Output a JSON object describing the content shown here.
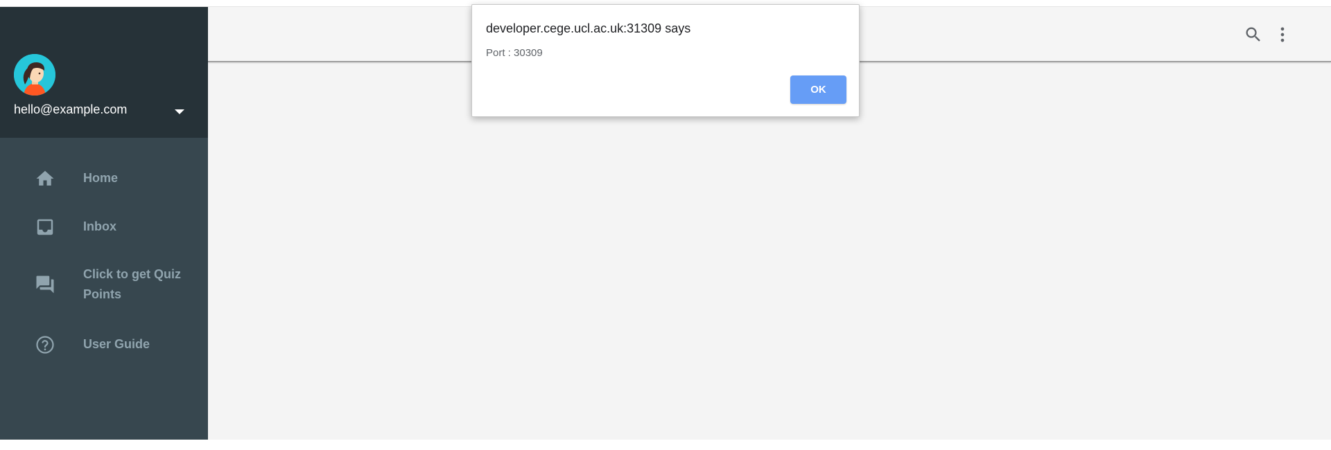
{
  "account": {
    "email": "hello@example.com"
  },
  "sidebar": {
    "items": [
      {
        "label": "Home",
        "icon": "home-icon"
      },
      {
        "label": "Inbox",
        "icon": "inbox-icon"
      },
      {
        "label": "Click to get Quiz Points",
        "icon": "forum-icon"
      },
      {
        "label": "User Guide",
        "icon": "help-icon"
      }
    ]
  },
  "toolbar": {
    "icons": [
      "search-icon",
      "more-vert-icon"
    ]
  },
  "dialog": {
    "title": "developer.cege.ucl.ac.uk:31309 says",
    "message": "Port : 30309",
    "ok_label": "OK"
  },
  "colors": {
    "sidebar_header": "#263238",
    "sidebar": "#37474f",
    "nav_text": "#90a4ae",
    "main_bg": "#f4f4f4",
    "ok_button": "#669df6"
  }
}
